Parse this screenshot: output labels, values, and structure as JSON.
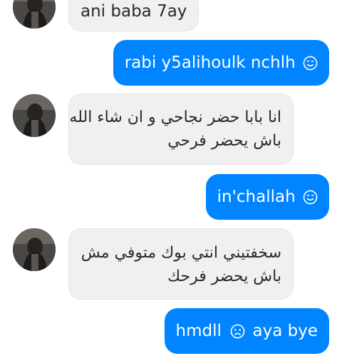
{
  "conversation": {
    "messages": [
      {
        "direction": "incoming",
        "text": "ani baba 7ay"
      },
      {
        "direction": "outgoing",
        "text": "rabi y5alihoulk nchlh",
        "emoji": "smiling-face-icon"
      },
      {
        "direction": "incoming",
        "lines": [
          "انا بابا حضر نجاحي و ان شاء الله",
          "باش يحضر فرحي"
        ]
      },
      {
        "direction": "outgoing",
        "text": "in'challah",
        "emoji": "smiling-face-icon"
      },
      {
        "direction": "incoming",
        "lines": [
          "سخفتيني  انتي بوك متوفي مش",
          "باش يحضر فرحك"
        ]
      },
      {
        "direction": "outgoing",
        "text_before": "hmdll",
        "emoji": "sad-face-icon",
        "text_after": "aya bye"
      }
    ]
  },
  "colors": {
    "outgoing_bubble": "#0084ff",
    "incoming_bubble": "#f1f0f0",
    "incoming_text": "#2a2a2a",
    "outgoing_text": "#ffffff"
  }
}
